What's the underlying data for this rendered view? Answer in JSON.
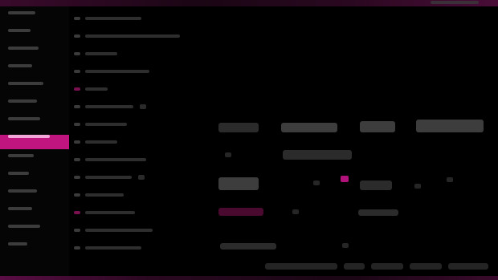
{
  "topbar": {
    "status_icon": "status-indicator-icon"
  },
  "sidebar": {
    "items": [
      {
        "name": "nav-item-1"
      },
      {
        "name": "nav-item-2"
      },
      {
        "name": "nav-item-3"
      },
      {
        "name": "nav-item-4"
      },
      {
        "name": "nav-item-5"
      },
      {
        "name": "nav-item-6"
      },
      {
        "name": "nav-item-7"
      },
      {
        "name": "nav-item-8",
        "active": true
      },
      {
        "name": "nav-item-9"
      },
      {
        "name": "nav-item-10"
      },
      {
        "name": "nav-item-11"
      },
      {
        "name": "nav-item-12"
      },
      {
        "name": "nav-item-13"
      },
      {
        "name": "nav-item-14"
      }
    ]
  },
  "tree": {
    "nodes": [
      {
        "name": "tree-node-1"
      },
      {
        "name": "tree-node-2"
      },
      {
        "name": "tree-node-3"
      },
      {
        "name": "tree-node-4"
      },
      {
        "name": "tree-node-5"
      },
      {
        "name": "tree-node-6"
      },
      {
        "name": "tree-node-7"
      },
      {
        "name": "tree-node-8"
      },
      {
        "name": "tree-node-9"
      },
      {
        "name": "tree-node-10"
      },
      {
        "name": "tree-node-11"
      },
      {
        "name": "tree-node-12"
      },
      {
        "name": "tree-node-13"
      },
      {
        "name": "tree-node-14"
      }
    ]
  },
  "colors": {
    "accent": "#c0157e",
    "accent_light": "#f2a7d8",
    "background": "#000000",
    "muted": "#2b2b2b"
  }
}
